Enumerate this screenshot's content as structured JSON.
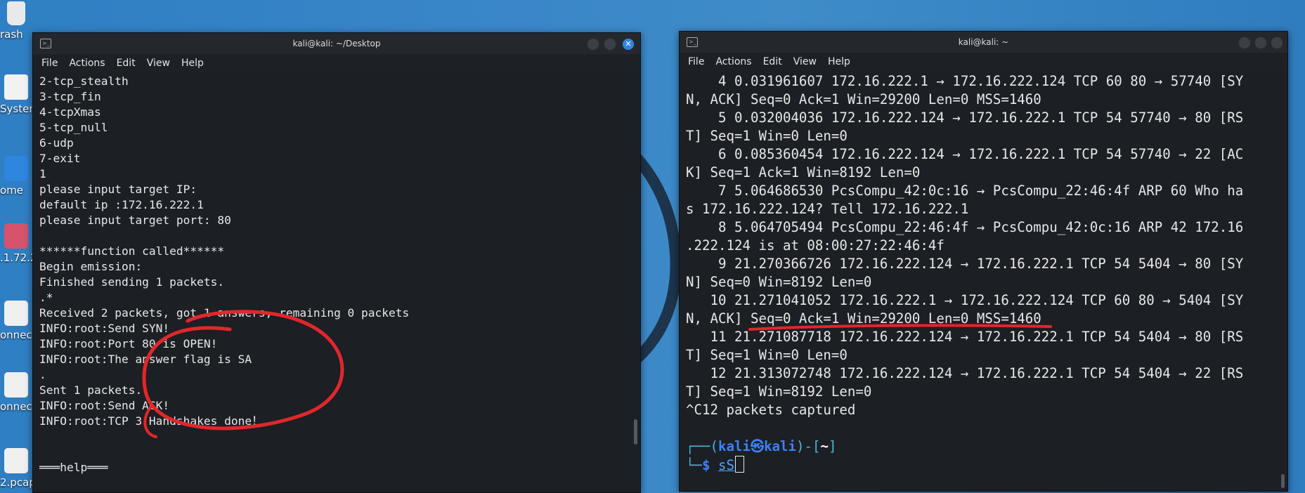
{
  "desktop": {
    "icons": [
      {
        "label": "rash"
      },
      {
        "label": "System"
      },
      {
        "label": "ome"
      },
      {
        "label": ".1.72.2."
      },
      {
        "label": "onnec..."
      },
      {
        "label": "onnec..."
      },
      {
        "label": "2.pcap"
      }
    ]
  },
  "left_window": {
    "title": "kali@kali: ~/Desktop",
    "menu": [
      "File",
      "Actions",
      "Edit",
      "View",
      "Help"
    ],
    "lines": [
      "2-tcp_stealth",
      "3-tcp_fin",
      "4-tcpXmas",
      "5-tcp_null",
      "6-udp",
      "7-exit",
      "1",
      "please input target IP:",
      "default ip :172.16.222.1",
      "please input target port: 80",
      "",
      "******function called******",
      "Begin emission:",
      "Finished sending 1 packets.",
      ".*",
      "Received 2 packets, got 1 answers, remaining 0 packets",
      "INFO:root:Send SYN!",
      "INFO:root:Port 80 is OPEN!",
      "INFO:root:The answer flag is SA",
      ".",
      "Sent 1 packets.",
      "INFO:root:Send ACK!",
      "INFO:root:TCP 3 Handshakes done！",
      "",
      "",
      "═══help═══"
    ]
  },
  "right_window": {
    "title": "kali@kali: ~",
    "menu": [
      "File",
      "Actions",
      "Edit",
      "View",
      "Help"
    ],
    "lines": [
      "    4 0.031961607 172.16.222.1 → 172.16.222.124 TCP 60 80 → 57740 [SY",
      "N, ACK] Seq=0 Ack=1 Win=29200 Len=0 MSS=1460",
      "    5 0.032004036 172.16.222.124 → 172.16.222.1 TCP 54 57740 → 80 [RS",
      "T] Seq=1 Win=0 Len=0",
      "    6 0.085360454 172.16.222.124 → 172.16.222.1 TCP 54 57740 → 22 [AC",
      "K] Seq=1 Ack=1 Win=8192 Len=0",
      "    7 5.064686530 PcsCompu_42:0c:16 → PcsCompu_22:46:4f ARP 60 Who ha",
      "s 172.16.222.124? Tell 172.16.222.1",
      "    8 5.064705494 PcsCompu_22:46:4f → PcsCompu_42:0c:16 ARP 42 172.16",
      ".222.124 is at 08:00:27:22:46:4f",
      "    9 21.270366726 172.16.222.124 → 172.16.222.1 TCP 54 5404 → 80 [SY",
      "N] Seq=0 Win=8192 Len=0",
      "   10 21.271041052 172.16.222.1 → 172.16.222.124 TCP 60 80 → 5404 [SY",
      "N, ACK] Seq=0 Ack=1 Win=29200 Len=0 MSS=1460",
      "   11 21.271087718 172.16.222.124 → 172.16.222.1 TCP 54 5404 → 80 [RS",
      "T] Seq=1 Win=0 Len=0",
      "   12 21.313072748 172.16.222.124 → 172.16.222.1 TCP 54 5404 → 22 [RS",
      "T] Seq=1 Win=8192 Len=0",
      "^C12 packets captured",
      ""
    ],
    "prompt": {
      "open": "┌──(",
      "user": "kali",
      "at": "㉿",
      "host": "kali",
      "mid": ")-[",
      "dir": "~",
      "close": "]",
      "line2": "└─",
      "dollar": "$",
      "command": "sS"
    }
  },
  "colors": {
    "desktop": "#3a86c8",
    "annotation_red": "#e3262b",
    "prompt_blue": "#3b82f6"
  }
}
